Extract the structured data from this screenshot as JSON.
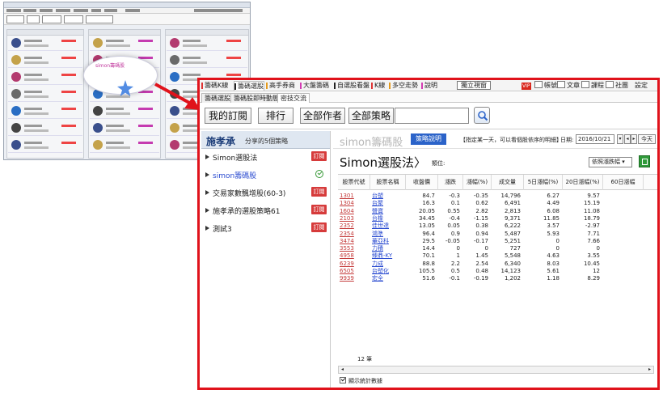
{
  "menu": {
    "tabs": [
      {
        "label": "籌碼K線",
        "bar": "#d33"
      },
      {
        "label": "籌碼選股",
        "bar": "#222",
        "active": true
      },
      {
        "label": "高手券商",
        "bar": "#e59a1c"
      },
      {
        "label": "大盤籌碼",
        "bar": "#d33bb3"
      },
      {
        "label": "自選股看盤",
        "bar": "#222"
      },
      {
        "label": "K線",
        "bar": "#d33"
      },
      {
        "label": "多空走勢",
        "bar": "#e59a1c"
      },
      {
        "label": "說明",
        "bar": "#d33bb3"
      }
    ],
    "new_window": "獨立視窗",
    "right": {
      "vip": "VIP",
      "account": "帳號",
      "article": "文章",
      "course": "課程",
      "community": "社團",
      "settings": "設定"
    }
  },
  "subtabs": [
    "籌碼選股",
    "籌碼股即時動態",
    "密技交流"
  ],
  "toolbar": {
    "my_subs": "我的訂閱",
    "rank": "排行",
    "all_authors": "全部作者",
    "all_strategies": "全部策略",
    "search_value": ""
  },
  "left": {
    "owner": "施孝承",
    "subtitle": "分享的5個策略",
    "strategies": [
      {
        "name": "Simon選股法",
        "status": "訂閱"
      },
      {
        "name": "simon籌碼股",
        "status": "check",
        "selected": true
      },
      {
        "name": "交易家數飄增股(60-3)",
        "status": "訂閱"
      },
      {
        "name": "施孝承的選股策略61",
        "status": "訂閱"
      },
      {
        "name": "測試3",
        "status": "訂閱"
      }
    ]
  },
  "right": {
    "title": "simon籌碼股",
    "guide": "策略說明",
    "hint": "【指定某一天，可以看個股依序的明細】",
    "date_label": "日期:",
    "date": "2016/10/21",
    "prev": "◂",
    "next": "▸",
    "today": "今天",
    "strategy_title": "Simon選股法〉",
    "location_label": "類位:",
    "sort": "依照漲跌幅 ▾",
    "columns": [
      "股票代號",
      "股票名稱",
      "收盤價",
      "漲跌",
      "漲幅(%)",
      "成交量",
      "5日漲幅(%)",
      "20日漲幅(%)",
      "60日漲幅"
    ],
    "rows": [
      [
        "1301",
        "台塑",
        "84.7",
        "-0.3",
        "-0.35",
        "14,796",
        "6.27",
        "9.57"
      ],
      [
        "1304",
        "台聚",
        "16.3",
        "0.1",
        "0.62",
        "6,491",
        "4.49",
        "15.19"
      ],
      [
        "1604",
        "聲寶",
        "20.05",
        "0.55",
        "2.82",
        "2,813",
        "6.08",
        "11.08"
      ],
      [
        "2103",
        "台橡",
        "34.45",
        "-0.4",
        "-1.15",
        "9,371",
        "11.85",
        "18.79"
      ],
      [
        "2352",
        "佳世達",
        "13.05",
        "0.05",
        "0.38",
        "6,222",
        "3.57",
        "-2.97"
      ],
      [
        "2354",
        "鴻準",
        "96.4",
        "0.9",
        "0.94",
        "5,487",
        "5.93",
        "7.71"
      ],
      [
        "3474",
        "華亞科",
        "29.5",
        "-0.05",
        "-0.17",
        "5,251",
        "0",
        "7.66"
      ],
      [
        "3553",
        "力積",
        "14.4",
        "0",
        "0",
        "727",
        "0",
        "0"
      ],
      [
        "4958",
        "臻鼎-KY",
        "70.1",
        "1",
        "1.45",
        "5,548",
        "4.63",
        "3.55"
      ],
      [
        "6239",
        "力成",
        "88.8",
        "2.2",
        "2.54",
        "6,340",
        "8.03",
        "10.45"
      ],
      [
        "6505",
        "台塑化",
        "105.5",
        "0.5",
        "0.48",
        "14,123",
        "5.61",
        "12"
      ],
      [
        "9939",
        "宏全",
        "51.6",
        "-0.1",
        "-0.19",
        "1,202",
        "1.18",
        "8.29"
      ]
    ],
    "count": "12 筆",
    "show_stats": "顯示統計數據"
  },
  "background": {
    "bubble_title": "simon籌碼股"
  }
}
